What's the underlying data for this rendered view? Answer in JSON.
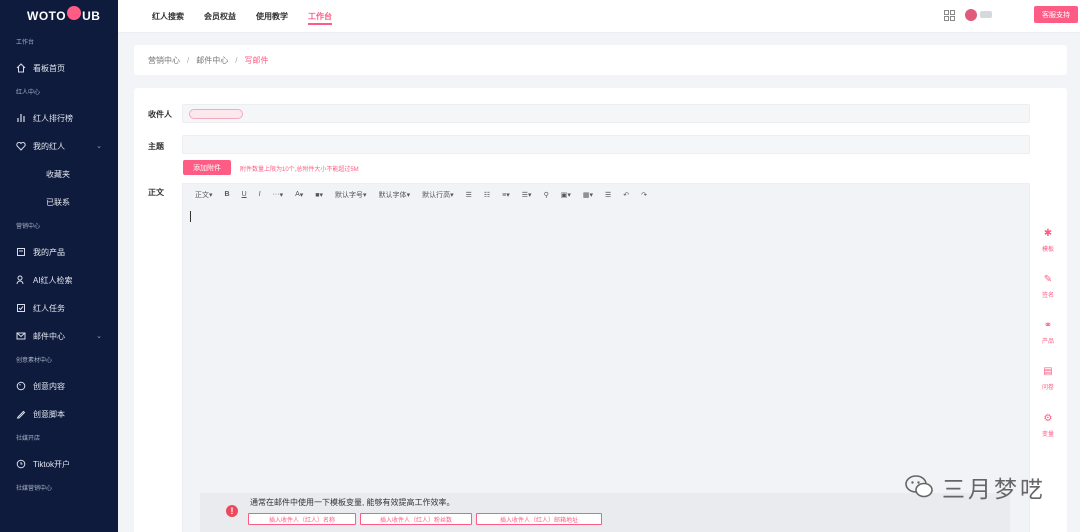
{
  "brand": {
    "logo_left": "WOTO",
    "logo_right": "UB"
  },
  "sidebar": {
    "sections": {
      "workbench": "工作台",
      "influencer_center": "红人中心",
      "marketing_center": "营销中心",
      "creative_center": "创意素材中心",
      "social_open": "社媒开店",
      "social_marketing": "社媒营销中心"
    },
    "items": {
      "dashboard": "看板首页",
      "ranking": "红人排行榜",
      "my_influencers": "我的红人",
      "favorites": "收藏夹",
      "contacted": "已联系",
      "my_products": "我的产品",
      "ai_search": "AI红人检索",
      "tasks": "红人任务",
      "mail_center": "邮件中心",
      "creative_content": "创意内容",
      "creative_script": "创意脚本",
      "tiktok": "Tiktok开户"
    }
  },
  "topbar": {
    "tabs": [
      "红人搜索",
      "会员权益",
      "使用教学",
      "工作台"
    ],
    "active_tab": "工作台",
    "contact_button": "客服支持"
  },
  "breadcrumb": {
    "items": [
      "营销中心",
      "邮件中心",
      "写邮件"
    ],
    "separator": "/"
  },
  "form": {
    "recipient_label": "收件人",
    "subject_label": "主题",
    "body_label": "正文",
    "attach_button": "添加附件",
    "attach_hint": "附件数量上限为10个,总附件大小不能超过5M"
  },
  "toolbar": {
    "paragraph": "正文",
    "bold": "B",
    "underline": "U",
    "italic": "I",
    "more": "···",
    "font_color": "A",
    "font_size": "默认字号",
    "font_family": "默认字体",
    "line_height": "默认行高"
  },
  "variables": {
    "tip": "通常在邮件中使用一下模板变量, 能够有效提高工作效率。",
    "buttons": [
      "插入收件人（红人）名称",
      "插入收件人（红人）粉丝数",
      "插入收件人（红人）邮箱地址"
    ]
  },
  "right_tools": [
    "模板",
    "签名",
    "产品",
    "问卷",
    "变量"
  ],
  "watermark": "三月梦呓",
  "colors": {
    "accent": "#ff5c85",
    "sidebar_bg": "#0f1b3d",
    "warning": "#ec4a5c"
  }
}
